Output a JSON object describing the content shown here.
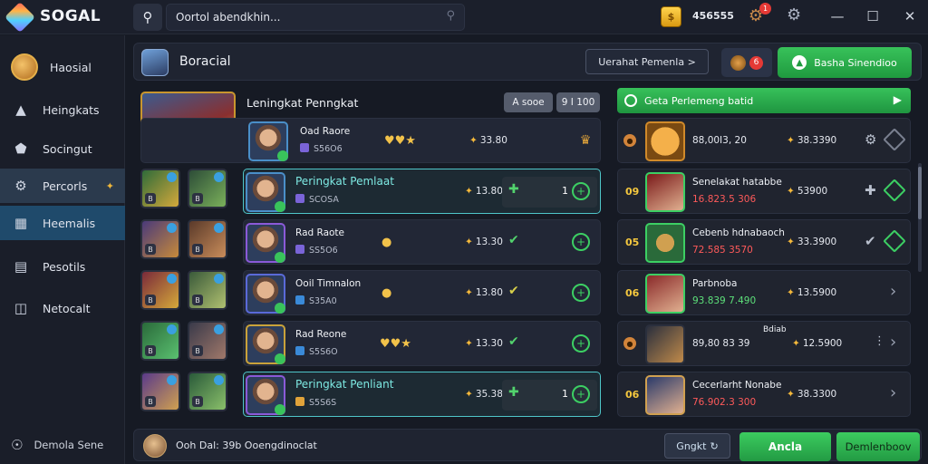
{
  "app": {
    "title": "SOGAL"
  },
  "search": {
    "value": "Oortol abendkhin...",
    "icon": "search-icon"
  },
  "topbar": {
    "coins": "456555",
    "coin_icon_label": "",
    "notif_badge": "1",
    "buttons": [
      "minimize",
      "maximize",
      "close"
    ]
  },
  "sidebar": {
    "items": [
      {
        "label": "Haosial",
        "icon": "avatar"
      },
      {
        "label": "Heingkats",
        "icon": "warning-icon"
      },
      {
        "label": "Socingut",
        "icon": "shield-icon"
      },
      {
        "label": "Percorls",
        "icon": "gear-icon"
      },
      {
        "label": "Heemalis",
        "icon": "folder-icon"
      },
      {
        "label": "Pesotils",
        "icon": "list-icon"
      },
      {
        "label": "Netocalt",
        "icon": "book-icon"
      }
    ],
    "footer": "Demola Sene"
  },
  "header": {
    "title": "Boracial",
    "tab_button": "Uerahat Pemenla >",
    "green_button": "Basha Sinendioo",
    "badge": "6"
  },
  "left_panel": {
    "title": "Leningkat Penngkat",
    "chips": [
      "A sooe",
      "9 I 100"
    ],
    "rows": [
      {
        "name": "Oad Raore",
        "sub": "S56O6",
        "mid": "♥♥★",
        "val": "33.80",
        "end": "gold",
        "highlight": false,
        "count": ""
      },
      {
        "name": "Peringkat Pemlaat",
        "sub": "SCOSA",
        "mid": "",
        "val": "13.80",
        "end": "green",
        "highlight": true,
        "count": "1"
      },
      {
        "name": "Rad Raote",
        "sub": "SS5O6",
        "mid": "●",
        "val": "13.30",
        "end": "green",
        "highlight": false,
        "count": ""
      },
      {
        "name": "Ooil Timnalon",
        "sub": "S35A0",
        "mid": "●",
        "val": "13.80",
        "end": "green",
        "highlight": false,
        "count": ""
      },
      {
        "name": "Rad Reone",
        "sub": "S5S6O",
        "mid": "♥♥★",
        "val": "13.30",
        "end": "green",
        "highlight": false,
        "count": ""
      },
      {
        "name": "Peringkat Penliant",
        "sub": "S5S6S",
        "mid": "",
        "val": "35.38",
        "end": "green",
        "highlight": true,
        "count": "1"
      }
    ]
  },
  "right_panel": {
    "header": "Geta Perlemeng batid",
    "rows": [
      {
        "rank": "●",
        "name": "",
        "score": "88,00I3, 20",
        "pts": "38.3390",
        "variant": "plain",
        "actions": "gear-diamond"
      },
      {
        "rank": "09",
        "name": "Senelakat hatabbe",
        "score": "16.823.5 306",
        "pts": "53900",
        "variant": "red",
        "actions": "plus-diamond"
      },
      {
        "rank": "05",
        "name": "Cebenb hdnabaoch",
        "score": "72.585 3570",
        "pts": "33.3900",
        "variant": "red",
        "actions": "check-diamond"
      },
      {
        "rank": "06",
        "name": "Parbnoba",
        "score": "93.839 7.490",
        "pts": "13.5900",
        "variant": "green",
        "actions": "chevron"
      },
      {
        "rank": "●",
        "name": "Bdiab",
        "score": "89,80 83 39",
        "pts": "12.5900",
        "variant": "plain",
        "actions": "dots-chevron"
      },
      {
        "rank": "06",
        "name": "Cecerlarht Nonabe",
        "score": "76.902.3 300",
        "pts": "38.3300",
        "variant": "red",
        "actions": "chevron"
      }
    ]
  },
  "bottombar": {
    "text": "Ooh Dal: 39b Ooengdinoclat",
    "btn1": "Gngkt",
    "btn2": "Ancla",
    "btn3": "Demlenboov"
  },
  "colors": {
    "accent_green": "#2fb64f",
    "highlight_cyan": "#4fc6c9",
    "gold": "#f5b93b",
    "score_red": "#ff5a5a",
    "bg": "#161a24"
  }
}
